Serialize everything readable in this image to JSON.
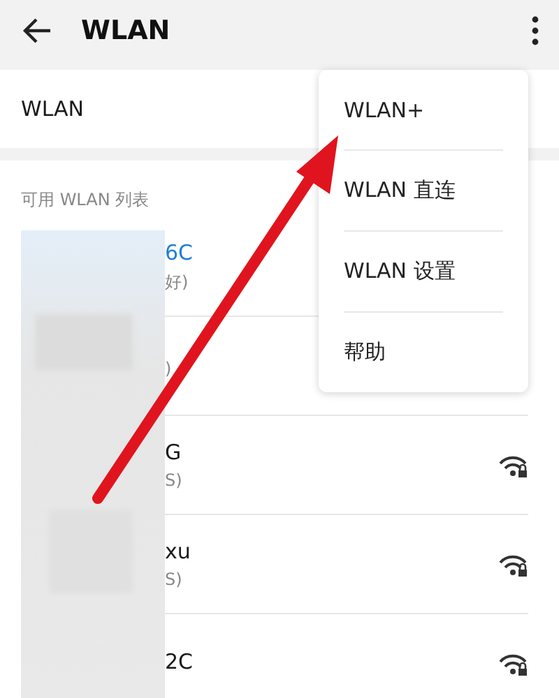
{
  "app_bar": {
    "title": "WLAN"
  },
  "wlan_row": {
    "label": "WLAN"
  },
  "list": {
    "heading": "可用 WLAN 列表",
    "networks": [
      {
        "name_end": "6C",
        "status_end": "好)",
        "connected": true
      },
      {
        "status_end": ")"
      },
      {
        "name_end": "G",
        "status_end": "S)",
        "connected": false,
        "signal_icon": true
      },
      {
        "name_end": "xu",
        "status_end": "S)",
        "connected": false,
        "signal_icon": true
      },
      {
        "name_end": "2C",
        "connected": false,
        "signal_icon": true
      }
    ]
  },
  "menu": {
    "items": [
      "WLAN+",
      "WLAN 直连",
      "WLAN 设置",
      "帮助"
    ]
  },
  "annotation": {
    "kind": "arrow"
  },
  "redaction": {
    "kind": "blur"
  }
}
